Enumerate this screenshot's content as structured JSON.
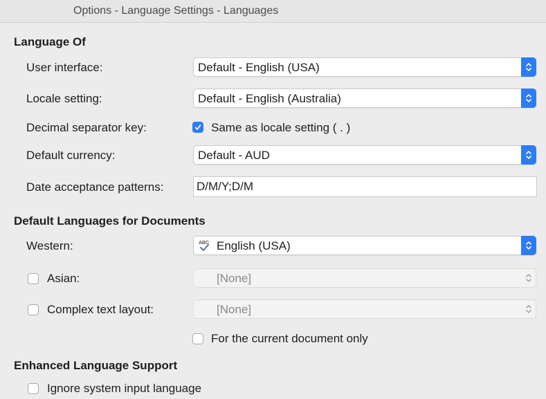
{
  "window": {
    "title": "Options - Language Settings - Languages"
  },
  "language_of": {
    "heading": "Language Of",
    "user_interface": {
      "label": "User interface:",
      "value": "Default - English (USA)"
    },
    "locale_setting": {
      "label": "Locale setting:",
      "value": "Default - English (Australia)"
    },
    "decimal_separator": {
      "label": "Decimal separator key:",
      "checkbox_label": "Same as locale setting ( . )",
      "checked": true
    },
    "default_currency": {
      "label": "Default currency:",
      "value": "Default - AUD"
    },
    "date_patterns": {
      "label": "Date acceptance patterns:",
      "value": "D/M/Y;D/M"
    }
  },
  "default_languages": {
    "heading": "Default Languages for Documents",
    "western": {
      "label": "Western:",
      "value": "English (USA)",
      "icon": "spellcheck-icon"
    },
    "asian": {
      "label": "Asian:",
      "value": "[None]",
      "checked": false
    },
    "ctl": {
      "label": "Complex text layout:",
      "value": "[None]",
      "checked": false
    },
    "current_doc_only": {
      "label": "For the current document only",
      "checked": false
    }
  },
  "enhanced_support": {
    "heading": "Enhanced Language Support",
    "ignore_input_lang": {
      "label": "Ignore system input language",
      "checked": false
    }
  },
  "colors": {
    "accent": "#2d7cf6",
    "background": "#ececec"
  }
}
